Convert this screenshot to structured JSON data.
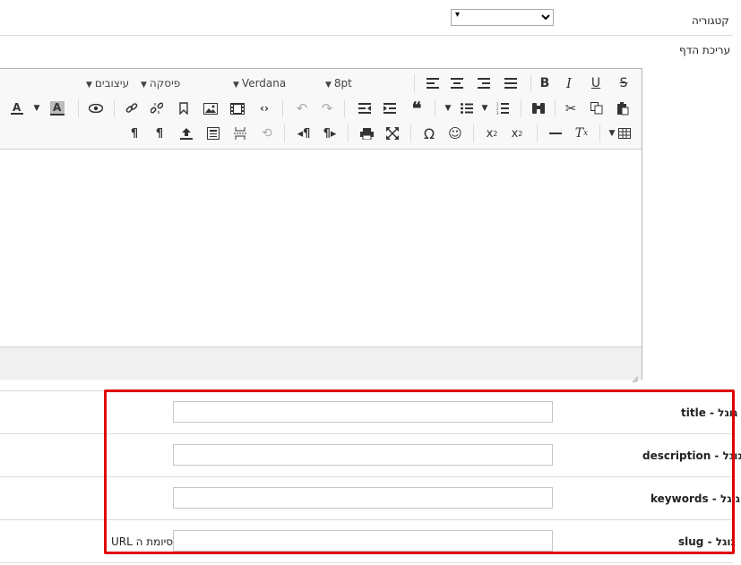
{
  "form": {
    "category_label": "קטגוריה",
    "category_value": "▾",
    "page_edit_label": "עריכת הדף"
  },
  "toolbar": {
    "styles_label": "עיצובים",
    "paragraph_label": "פיסקה",
    "font_label": "Verdana",
    "size_label": "8pt"
  },
  "seo": {
    "title_label": "גוגל - title",
    "description_label": "גוגל - description",
    "keywords_label": "גוגל - keywords",
    "slug_label": "גוגל - slug",
    "slug_suffix": "סיומת ה URL",
    "title_value": "",
    "description_value": "",
    "keywords_value": "",
    "slug_value": ""
  },
  "colors": {
    "highlight_border": "#e00000",
    "toolbar_bg": "#f8f8f8"
  }
}
